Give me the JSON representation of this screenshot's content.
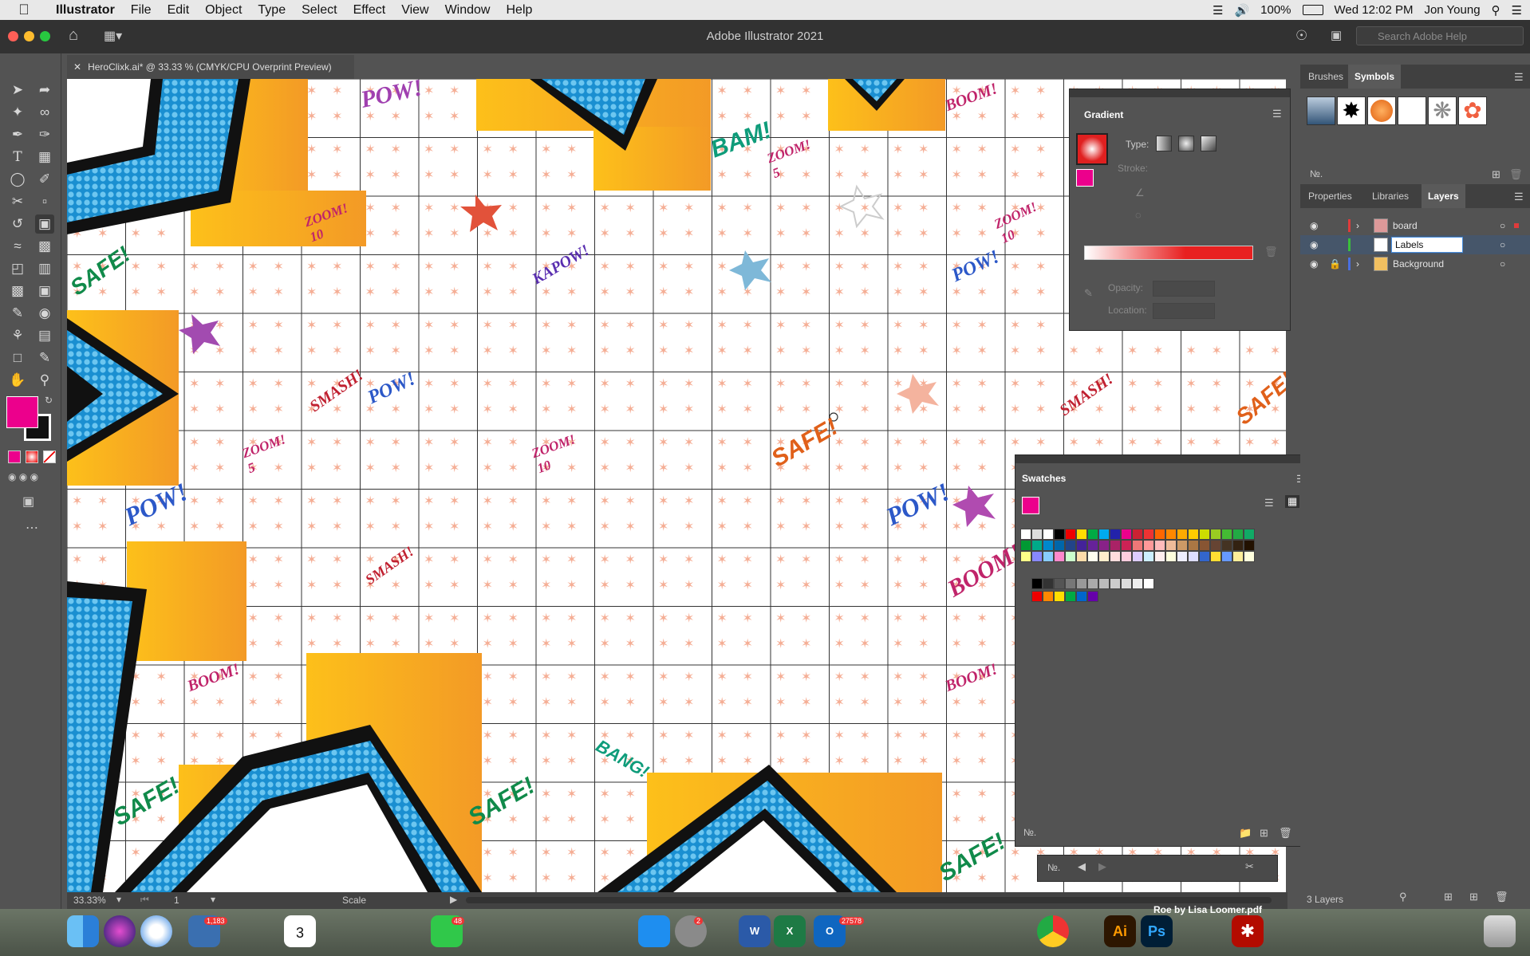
{
  "menubar": {
    "app_name": "Illustrator",
    "menus": [
      "File",
      "Edit",
      "Object",
      "Type",
      "Select",
      "Effect",
      "View",
      "Window",
      "Help"
    ],
    "battery": "100%",
    "datetime": "Wed 12:02 PM",
    "user": "Jon Young"
  },
  "window": {
    "title": "Adobe Illustrator 2021",
    "help_placeholder": "Search Adobe Help"
  },
  "document": {
    "tab_label": "HeroClixk.ai* @ 33.33 % (CMYK/CPU Overprint Preview)"
  },
  "canvas_labels": [
    "POW!",
    "BAM!",
    "ZOOM! 5",
    "ZOOM! 10",
    "SAFE!",
    "KAPOW!",
    "SMASH!",
    "BOOM!",
    "BANG!"
  ],
  "status": {
    "zoom": "33.33%",
    "artboard": "1",
    "tool_name": "Scale"
  },
  "gradient_panel": {
    "title": "Gradient",
    "type_label": "Type:",
    "stroke_label": "Stroke:",
    "opacity_label": "Opacity:",
    "location_label": "Location:"
  },
  "swatches_panel": {
    "title": "Swatches"
  },
  "right_dock": {
    "top_tabs": [
      "Brushes",
      "Symbols"
    ],
    "bottom_tabs": [
      "Properties",
      "Libraries",
      "Layers"
    ],
    "layers": [
      {
        "name": "board",
        "color": "#e03b3b"
      },
      {
        "name": "Labels",
        "color": "#3bbf3b"
      },
      {
        "name": "Background",
        "color": "#4a6fe0"
      }
    ],
    "layer_count": "3 Layers"
  },
  "dock": {
    "pdf_label": "Roe by Lisa Loomer.pdf",
    "badges": {
      "photos": "1,183",
      "calendar": "3",
      "messages": "48",
      "prefs": "2",
      "outlook": "27578"
    }
  },
  "colors": {
    "fill": "#ec008c",
    "accent_blue": "#29a6e0",
    "orange": "#f7a11a",
    "tile": "#f4a58a"
  }
}
